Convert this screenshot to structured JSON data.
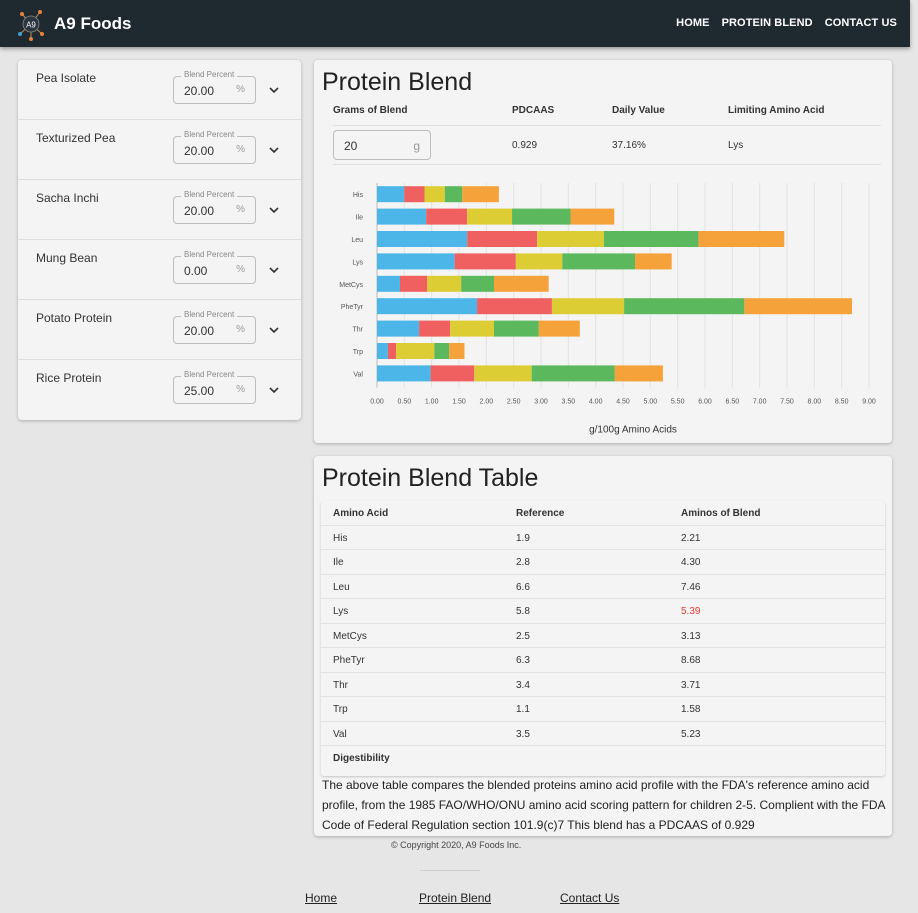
{
  "header": {
    "brand": "A9 Foods",
    "logo_text": "A9",
    "nav": [
      "HOME",
      "PROTEIN BLEND",
      "CONTACT US"
    ]
  },
  "ingredients": [
    {
      "name": "Pea Isolate",
      "label": "Blend Percent",
      "value": "20.00",
      "unit": "%"
    },
    {
      "name": "Texturized Pea",
      "label": "Blend Percent",
      "value": "20.00",
      "unit": "%"
    },
    {
      "name": "Sacha Inchi",
      "label": "Blend Percent",
      "value": "20.00",
      "unit": "%"
    },
    {
      "name": "Mung Bean",
      "label": "Blend Percent",
      "value": "0.00",
      "unit": "%"
    },
    {
      "name": "Potato Protein",
      "label": "Blend Percent",
      "value": "20.00",
      "unit": "%"
    },
    {
      "name": "Rice Protein",
      "label": "Blend Percent",
      "value": "25.00",
      "unit": "%"
    }
  ],
  "blend": {
    "title": "Protein Blend",
    "headers": {
      "grams": "Grams of Blend",
      "pdcaas": "PDCAAS",
      "daily": "Daily Value",
      "limiting": "Limiting Amino Acid"
    },
    "grams_value": "20",
    "grams_unit": "g",
    "pdcaas": "0.929",
    "daily": "37.16%",
    "limiting": "Lys"
  },
  "chart_data": {
    "type": "bar",
    "orientation": "horizontal",
    "stacked": true,
    "categories": [
      "His",
      "Ile",
      "Leu",
      "Lys",
      "MetCys",
      "PheTyr",
      "Thr",
      "Trp",
      "Val"
    ],
    "series": [
      {
        "color": "#4db6e8",
        "values": [
          0.5,
          0.9,
          1.65,
          1.42,
          0.42,
          1.83,
          0.77,
          0.2,
          0.98
        ]
      },
      {
        "color": "#f06060",
        "values": [
          0.37,
          0.75,
          1.28,
          1.12,
          0.5,
          1.37,
          0.57,
          0.15,
          0.8
        ]
      },
      {
        "color": "#dccd35",
        "values": [
          0.37,
          0.82,
          1.22,
          0.85,
          0.62,
          1.32,
          0.8,
          0.7,
          1.05
        ]
      },
      {
        "color": "#5cb85c",
        "values": [
          0.32,
          1.07,
          1.73,
          1.33,
          0.6,
          2.2,
          0.82,
          0.27,
          1.52
        ]
      },
      {
        "color": "#f5a23a",
        "values": [
          0.67,
          0.8,
          1.57,
          0.67,
          1.0,
          1.97,
          0.75,
          0.28,
          0.88
        ]
      }
    ],
    "xticks": [
      "0.00",
      "0.50",
      "1.00",
      "1.50",
      "2.00",
      "2.50",
      "3.00",
      "3.50",
      "4.00",
      "4.50",
      "5.00",
      "5.50",
      "6.00",
      "6.50",
      "7.00",
      "7.50",
      "8.00",
      "8.50",
      "9.00"
    ],
    "xlim": [
      0,
      9
    ],
    "xlabel": "g/100g Amino Acids",
    "grid": true
  },
  "table": {
    "title": "Protein Blend Table",
    "headers": [
      "Amino Acid",
      "Reference",
      "Aminos of Blend"
    ],
    "rows": [
      [
        "His",
        "1.9",
        "2.21"
      ],
      [
        "Ile",
        "2.8",
        "4.30"
      ],
      [
        "Leu",
        "6.6",
        "7.46"
      ],
      [
        "Lys",
        "5.8",
        "5.39"
      ],
      [
        "MetCys",
        "2.5",
        "3.13"
      ],
      [
        "PheTyr",
        "6.3",
        "8.68"
      ],
      [
        "Thr",
        "3.4",
        "3.71"
      ],
      [
        "Trp",
        "1.1",
        "1.58"
      ],
      [
        "Val",
        "3.5",
        "5.23"
      ]
    ],
    "footer_label": "Digestibility",
    "highlight_color": "#e53935",
    "description": "The above table compares the blended proteins amino acid profile with the FDA's reference amino acid profile, from the 1985 FAO/WHO/ONU amino acid scoring pattern for children 2-5. Complient with the FDA Code of Federal Regulation section 101.9(c)7 This blend has a PDCAAS of 0.929"
  },
  "footer": {
    "copyright": "© Copyright 2020, A9 Foods Inc.",
    "links": [
      "Home",
      "Protein Blend",
      "Contact Us"
    ]
  }
}
